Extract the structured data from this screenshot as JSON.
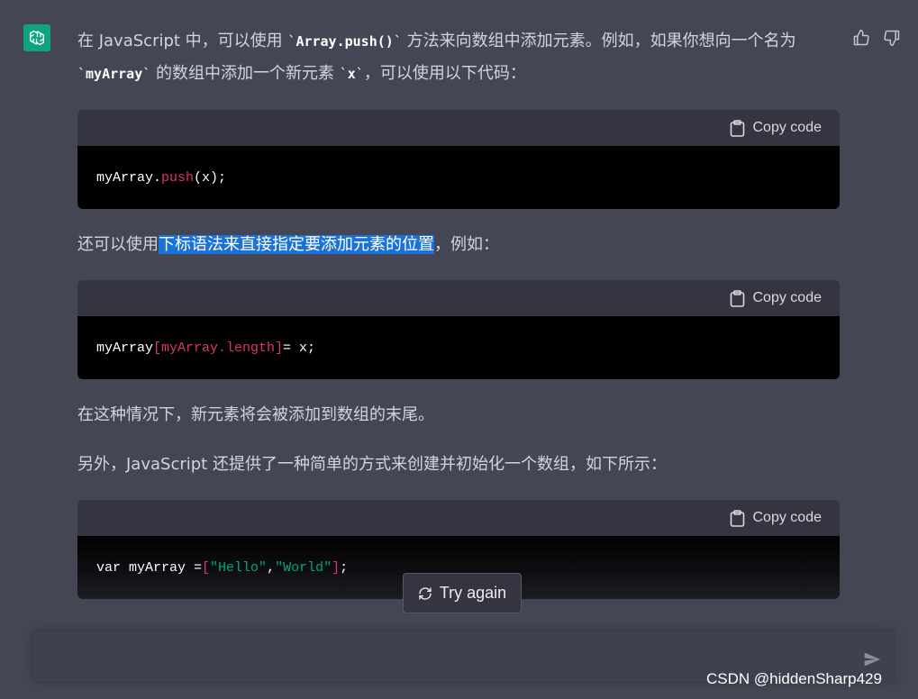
{
  "assistant": {
    "avatar_icon": "openai-logo-icon",
    "avatar_color": "#10a37f"
  },
  "feedback": {
    "thumbs_up_icon": "thumbs-up-icon",
    "thumbs_down_icon": "thumbs-down-icon"
  },
  "message": {
    "p1": {
      "text_a": "在 JavaScript 中，可以使用 ",
      "code_a": "Array.push()",
      "text_b": " 方法来向数组中添加元素。例如，如果你想向一个名为 ",
      "code_b": "myArray",
      "text_c": " 的数组中添加一个新元素 ",
      "code_c": "x",
      "text_d": "，可以使用以下代码："
    },
    "p2": {
      "text_a": "还可以使用",
      "highlight": "下标语法来直接指定要添加元素的位置",
      "text_b": "，例如："
    },
    "p3": "在这种情况下，新元素将会被添加到数组的末尾。",
    "p4": "另外，JavaScript 还提供了一种简单的方式来创建并初始化一个数组，如下所示："
  },
  "code_blocks": [
    {
      "copy_label": "Copy code",
      "tokens": [
        "myArray.",
        "push",
        "(x);"
      ]
    },
    {
      "copy_label": "Copy code",
      "tokens": [
        "myArray",
        "[myArray.length]",
        " = x;"
      ]
    },
    {
      "copy_label": "Copy code",
      "tokens": [
        "var myArray = ",
        "[",
        "\"Hello\"",
        ", ",
        "\"World\"",
        "]",
        ";"
      ]
    }
  ],
  "try_again": {
    "label": "Try again",
    "icon": "refresh-icon"
  },
  "input": {
    "value": "",
    "send_icon": "send-icon"
  },
  "watermark": "CSDN @hiddenSharp429",
  "colors": {
    "background": "#444654",
    "code_header": "#343541",
    "code_body": "#000000",
    "highlight": "#1a72d8",
    "token_pink": "#df3079",
    "token_green": "#00a67d"
  }
}
